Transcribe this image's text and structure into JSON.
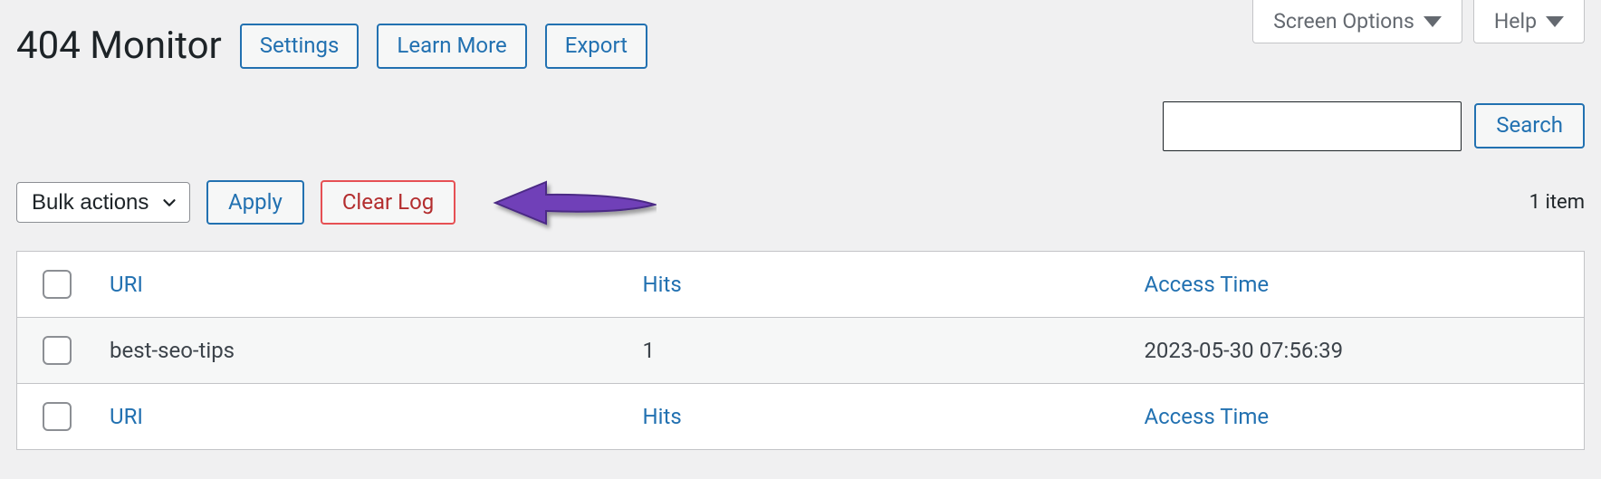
{
  "topbar": {
    "screen_options": "Screen Options",
    "help": "Help"
  },
  "header": {
    "title": "404 Monitor",
    "settings": "Settings",
    "learn_more": "Learn More",
    "export": "Export"
  },
  "search": {
    "value": "",
    "placeholder": "",
    "button": "Search"
  },
  "actions": {
    "bulk_label": "Bulk actions",
    "apply": "Apply",
    "clear_log": "Clear Log"
  },
  "count_text": "1 item",
  "columns": {
    "uri": "URI",
    "hits": "Hits",
    "access": "Access Time"
  },
  "rows": [
    {
      "uri": "best-seo-tips",
      "hits": "1",
      "access": "2023-05-30 07:56:39"
    }
  ],
  "colors": {
    "accent": "#2271b1",
    "danger": "#b32d2e",
    "arrow": "#6f3fb8"
  }
}
